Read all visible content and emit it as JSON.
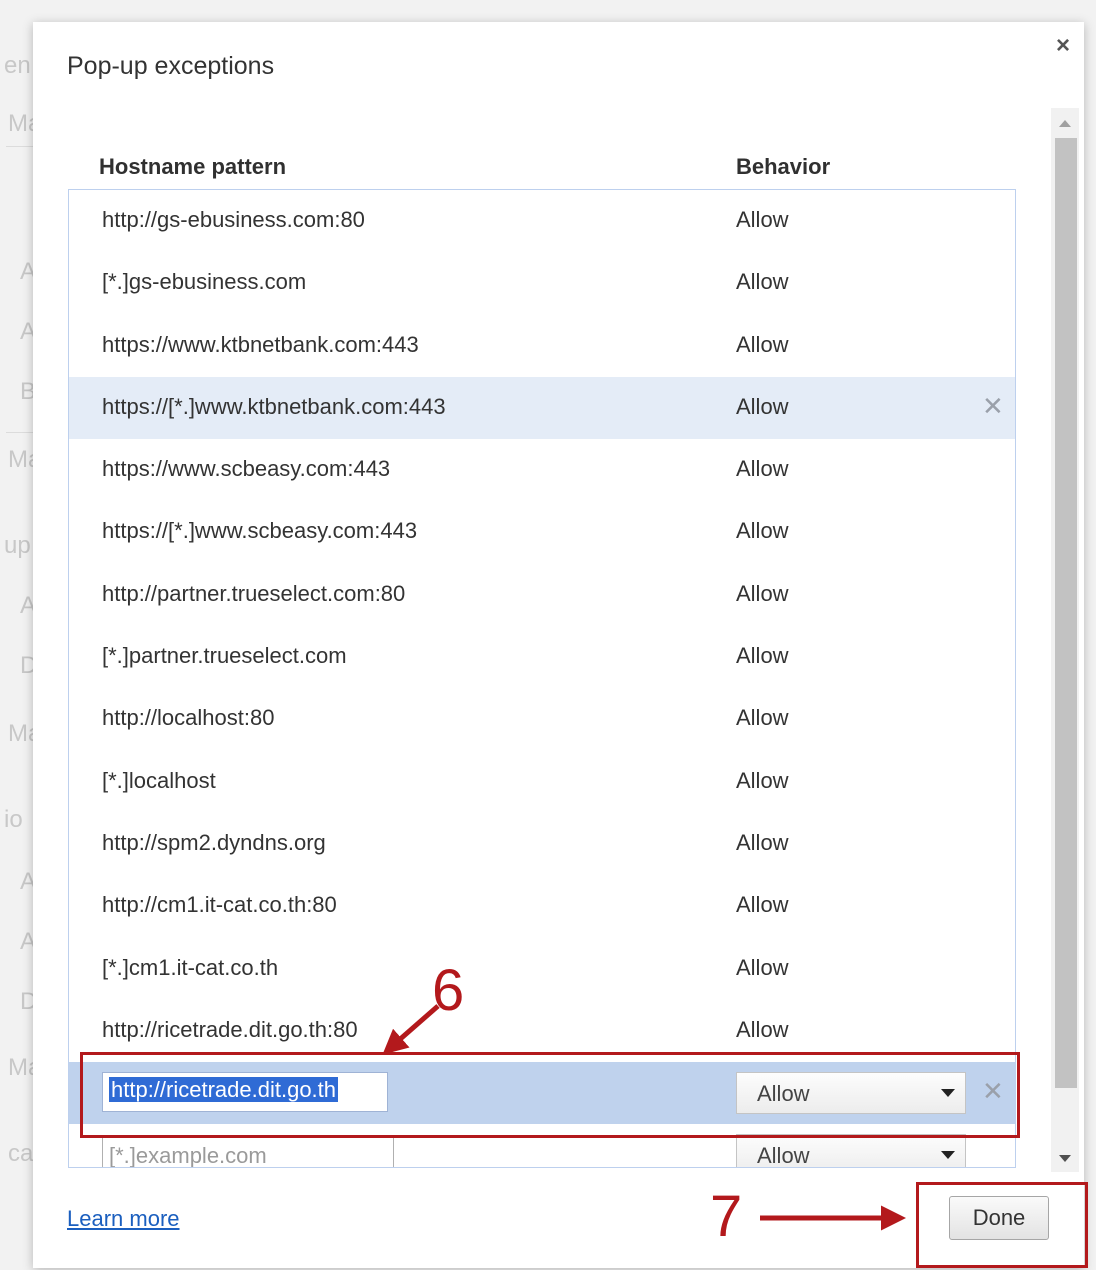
{
  "dialog": {
    "title": "Pop-up exceptions",
    "close_glyph": "×"
  },
  "columns": {
    "host": "Hostname pattern",
    "behavior": "Behavior"
  },
  "rows": [
    {
      "host": "http://gs-ebusiness.com:80",
      "behavior": "Allow"
    },
    {
      "host": "[*.]gs-ebusiness.com",
      "behavior": "Allow"
    },
    {
      "host": "https://www.ktbnetbank.com:443",
      "behavior": "Allow"
    },
    {
      "host": "https://[*.]www.ktbnetbank.com:443",
      "behavior": "Allow"
    },
    {
      "host": "https://www.scbeasy.com:443",
      "behavior": "Allow"
    },
    {
      "host": "https://[*.]www.scbeasy.com:443",
      "behavior": "Allow"
    },
    {
      "host": "http://partner.trueselect.com:80",
      "behavior": "Allow"
    },
    {
      "host": "[*.]partner.trueselect.com",
      "behavior": "Allow"
    },
    {
      "host": "http://localhost:80",
      "behavior": "Allow"
    },
    {
      "host": "[*.]localhost",
      "behavior": "Allow"
    },
    {
      "host": "http://spm2.dyndns.org",
      "behavior": "Allow"
    },
    {
      "host": "http://cm1.it-cat.co.th:80",
      "behavior": "Allow"
    },
    {
      "host": "[*.]cm1.it-cat.co.th",
      "behavior": "Allow"
    },
    {
      "host": "http://ricetrade.dit.go.th:80",
      "behavior": "Allow"
    }
  ],
  "highlighted_row_index": 3,
  "edit_row": {
    "value": "http://ricetrade.dit.go.th",
    "behavior": "Allow"
  },
  "new_row": {
    "placeholder": "[*.]example.com",
    "behavior": "Allow"
  },
  "footer": {
    "learn_more": "Learn more",
    "done": "Done"
  },
  "annotations": {
    "step6": "6",
    "step7": "7",
    "color": "#b3191c"
  },
  "colors": {
    "selection": "#2f6bd5",
    "edit_row_bg": "#bfd2ed",
    "highlight_row_bg": "#e4ecf7",
    "link": "#1b5fbf"
  }
}
